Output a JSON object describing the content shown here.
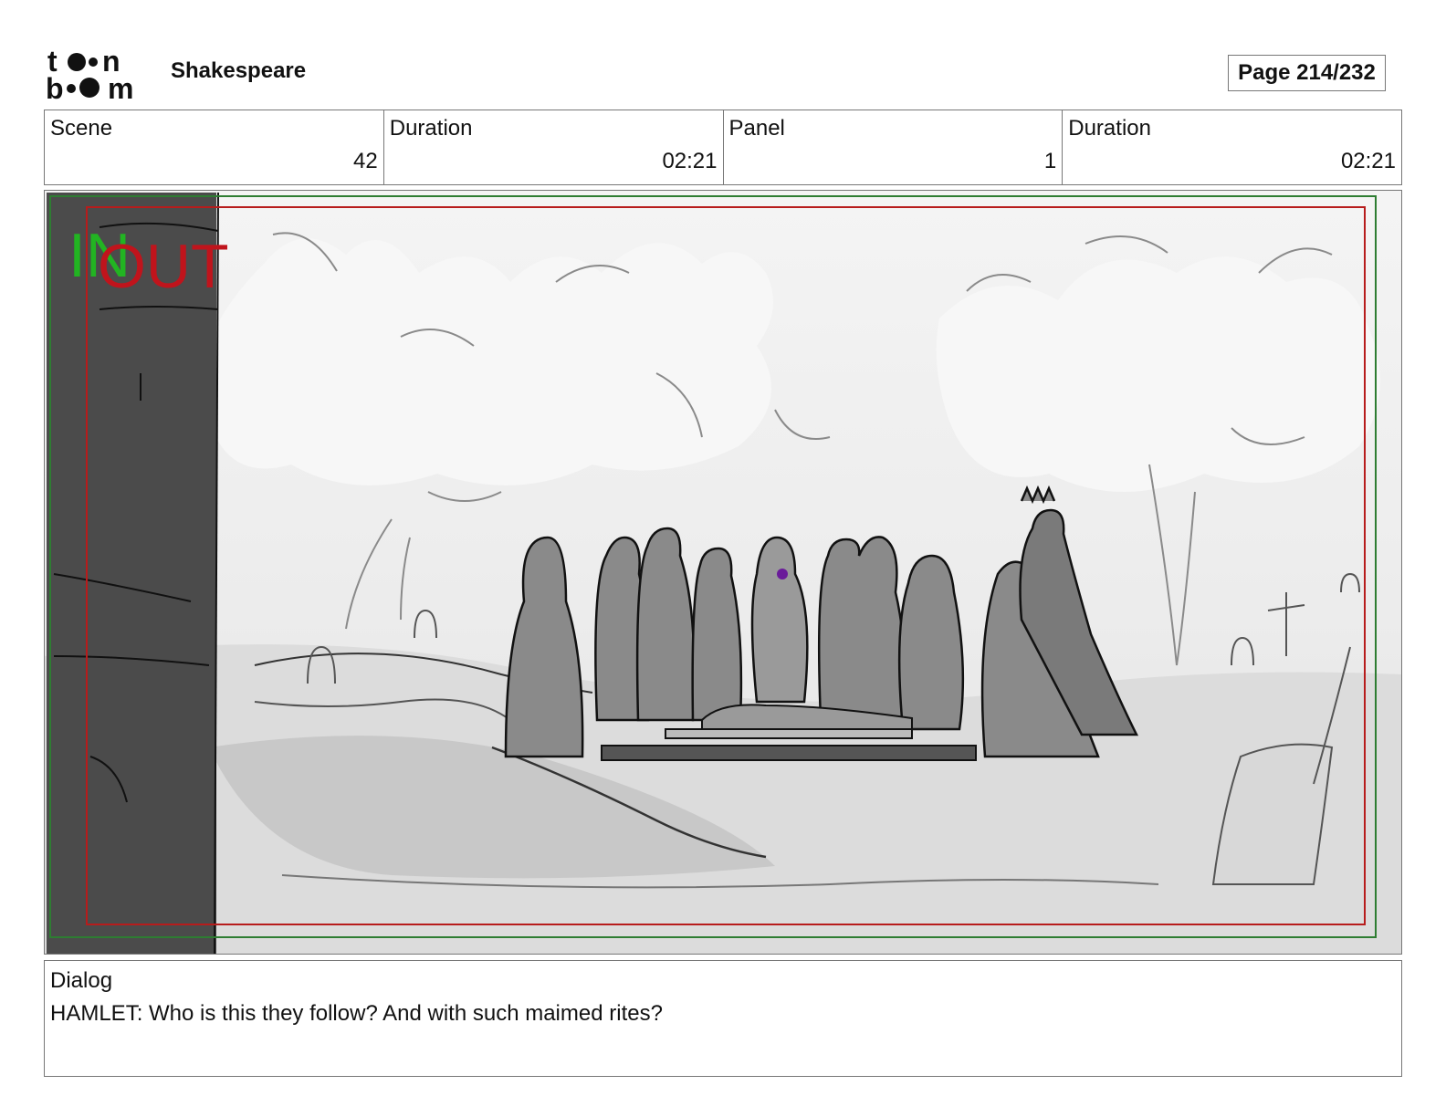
{
  "header": {
    "logo_text": "toon boom",
    "project_title": "Shakespeare",
    "page_indicator": "Page 214/232"
  },
  "info": {
    "scene_label": "Scene",
    "scene_value": "42",
    "scene_duration_label": "Duration",
    "scene_duration_value": "02:21",
    "panel_label": "Panel",
    "panel_value": "1",
    "panel_duration_label": "Duration",
    "panel_duration_value": "02:21"
  },
  "panel": {
    "in_marker": "IN",
    "out_marker": "OUT",
    "colors": {
      "in_frame": "#2e7d32",
      "out_frame": "#b71c1c",
      "in_text": "#22b422",
      "out_text": "#c0141c"
    }
  },
  "dialog": {
    "label": "Dialog",
    "text": "HAMLET: Who is this they follow? And with such maimed rites?"
  }
}
